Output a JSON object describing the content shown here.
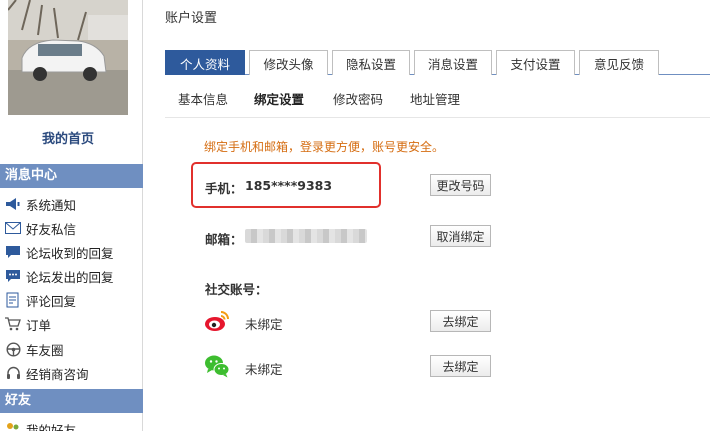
{
  "sidebar": {
    "homepage": "我的首页",
    "message_center": "消息中心",
    "messages": [
      {
        "label": "系统通知",
        "icon": "megaphone-icon"
      },
      {
        "label": "好友私信",
        "icon": "envelope-icon"
      },
      {
        "label": "论坛收到的回复",
        "icon": "chat-in-icon"
      },
      {
        "label": "论坛发出的回复",
        "icon": "chat-out-icon"
      },
      {
        "label": "评论回复",
        "icon": "edit-icon"
      },
      {
        "label": "订单",
        "icon": "cart-icon"
      },
      {
        "label": "车友圈",
        "icon": "steering-wheel-icon"
      },
      {
        "label": "经销商咨询",
        "icon": "headset-icon"
      }
    ],
    "friends_header": "好友",
    "friends": [
      {
        "label": "我的好友",
        "icon": "friends-icon"
      }
    ]
  },
  "header": {
    "title": "账户设置"
  },
  "tabs": [
    "个人资料",
    "修改头像",
    "隐私设置",
    "消息设置",
    "支付设置",
    "意见反馈"
  ],
  "subtabs": [
    "基本信息",
    "绑定设置",
    "修改密码",
    "地址管理"
  ],
  "binding": {
    "notice": "绑定手机和邮箱，登录更方便，账号更安全。",
    "phone_label": "手机：",
    "phone_value": "185****9383",
    "phone_button": "更改号码",
    "email_label": "邮箱：",
    "email_button": "取消绑定",
    "social_label": "社交账号：",
    "social": [
      {
        "icon": "weibo-icon",
        "status": "未绑定",
        "button": "去绑定"
      },
      {
        "icon": "wechat-icon",
        "status": "未绑定",
        "button": "去绑定"
      }
    ]
  },
  "colors": {
    "accent": "#2e5a9c",
    "sidebar_header": "#6f8fc1",
    "notice": "#d56d12",
    "highlight": "#e1302c"
  }
}
